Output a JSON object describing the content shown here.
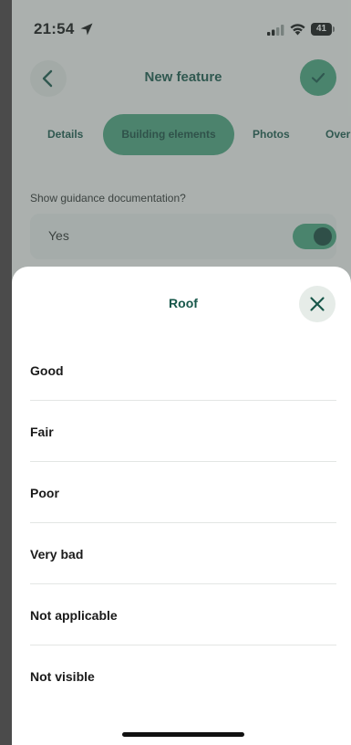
{
  "status_bar": {
    "time": "21:54",
    "battery": "41",
    "icons": [
      "location-arrow-icon",
      "cellular-signal-icon",
      "wifi-icon",
      "battery-icon"
    ]
  },
  "header": {
    "title": "New feature",
    "back_icon": "chevron-left-icon",
    "confirm_icon": "checkmark-icon"
  },
  "tabs": [
    {
      "label": "Details",
      "active": false
    },
    {
      "label": "Building elements",
      "active": true
    },
    {
      "label": "Photos",
      "active": false
    },
    {
      "label": "Over",
      "active": false
    }
  ],
  "guidance": {
    "label": "Show guidance documentation?",
    "value": "Yes",
    "toggle_on": true
  },
  "sheet": {
    "title": "Roof",
    "close_icon": "close-icon",
    "options": [
      {
        "label": "Good"
      },
      {
        "label": "Fair"
      },
      {
        "label": "Poor"
      },
      {
        "label": "Very bad"
      },
      {
        "label": "Not applicable"
      },
      {
        "label": "Not visible"
      }
    ]
  },
  "colors": {
    "accent": "#45a77e",
    "accent_dark": "#17574a",
    "sheet_bg": "#ffffff"
  }
}
